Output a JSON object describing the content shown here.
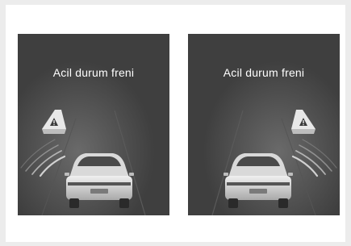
{
  "panels": [
    {
      "title": "Acil durum freni",
      "radar_side": "left"
    },
    {
      "title": "Acil durum freni",
      "radar_side": "right"
    }
  ],
  "colors": {
    "page_background": "#ececec",
    "frame_background": "#ffffff",
    "panel_background": "#3f3f3f",
    "title_text": "#ffffff",
    "warning_icon": "#e8e8e8"
  },
  "icons": {
    "obstacle": "warning-triangle-icon",
    "vehicle": "car-rear-icon",
    "radar": "radar-waves-icon"
  }
}
